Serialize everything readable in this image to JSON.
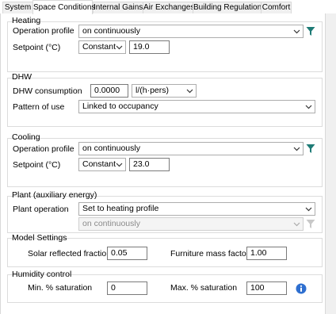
{
  "tabs": [
    "System",
    "Space Conditions",
    "Internal Gains",
    "Air Exchanges",
    "Building Regulations",
    "Comfort"
  ],
  "active_tab": "Space Conditions",
  "heating": {
    "title": "Heating",
    "operation_profile_label": "Operation profile",
    "operation_profile_value": "on continuously",
    "setpoint_label": "Setpoint (°C)",
    "setpoint_mode": "Constant",
    "setpoint_value": "19.0"
  },
  "dhw": {
    "title": "DHW",
    "consumption_label": "DHW consumption",
    "consumption_value": "0.0000",
    "consumption_unit": "l/(h·pers)",
    "pattern_label": "Pattern of use",
    "pattern_value": "Linked to occupancy"
  },
  "cooling": {
    "title": "Cooling",
    "operation_profile_label": "Operation profile",
    "operation_profile_value": "on continuously",
    "setpoint_label": "Setpoint (°C)",
    "setpoint_mode": "Constant",
    "setpoint_value": "23.0"
  },
  "plant": {
    "title": "Plant (auxiliary energy)",
    "operation_label": "Plant operation",
    "operation_value": "Set to heating profile",
    "secondary_value": "on continuously"
  },
  "model_settings": {
    "title": "Model Settings",
    "solar_label": "Solar reflected fraction",
    "solar_value": "0.05",
    "furniture_label": "Furniture mass factor",
    "furniture_value": "1.00"
  },
  "humidity": {
    "title": "Humidity control",
    "min_label": "Min. % saturation",
    "min_value": "0",
    "max_label": "Max. % saturation",
    "max_value": "100"
  },
  "colors": {
    "filter_icon": "#1e7b76",
    "info_icon": "#2e6fd0",
    "tab_border": "#d9d9d9",
    "group_border": "#dcdcdc"
  },
  "icons": {
    "dropdown": "chevron-down-icon",
    "profile_filter": "filter-icon",
    "info": "info-icon"
  }
}
